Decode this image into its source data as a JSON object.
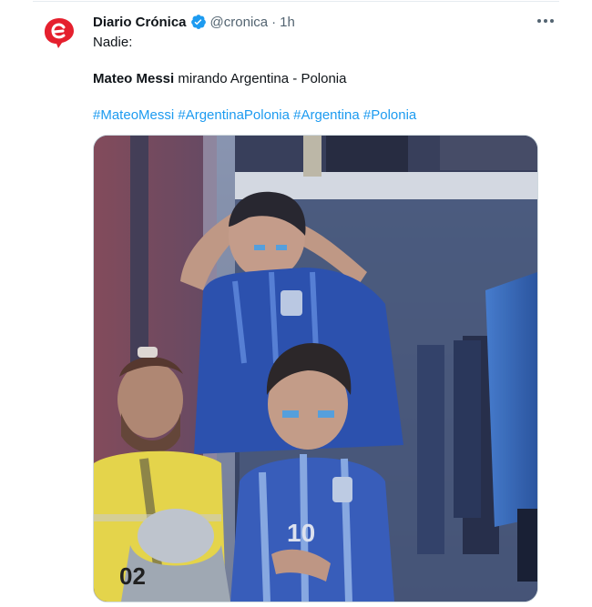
{
  "tweet": {
    "author_name": "Diario Crónica",
    "handle": "@cronica",
    "separator": "·",
    "time": "1h",
    "verified": true,
    "lines": {
      "line1": "Nadie:",
      "line2_bold": "Mateo Messi",
      "line2_rest": " mirando Argentina - Polonia"
    },
    "hashtags": [
      "#MateoMessi",
      "#ArgentinaPolonia",
      "#Argentina",
      "#Polonia"
    ],
    "avatar_icon": "cronica-logo-icon",
    "more_icon": "more-options-icon",
    "image": {
      "description_icon": "photo-media",
      "jersey_number": "10",
      "vest_text": "02"
    }
  },
  "colors": {
    "link": "#1d9bf0",
    "verified_badge": "#1d9bf0",
    "brand_red": "#e5202e",
    "muted": "#536471"
  }
}
